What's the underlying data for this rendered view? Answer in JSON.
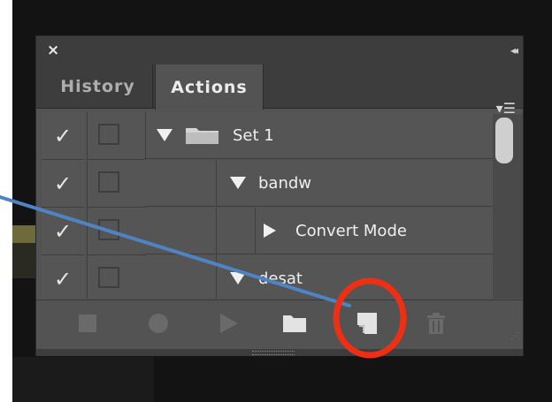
{
  "panel": {
    "close_icon": "close-icon",
    "collapse_icon": "collapse-double-arrow-icon",
    "tabs": [
      {
        "label": "History",
        "active": false
      },
      {
        "label": "Actions",
        "active": true
      }
    ],
    "panel_menu_icon": "panel-menu-icon"
  },
  "rows": [
    {
      "check": "✓",
      "expand": "down",
      "icon": "folder-icon",
      "label": "Set 1"
    },
    {
      "check": "✓",
      "expand": "down",
      "icon": "",
      "label": "bandw"
    },
    {
      "check": "✓",
      "expand": "right",
      "icon": "",
      "label": "Convert Mode"
    },
    {
      "check": "✓",
      "expand": "down",
      "icon": "",
      "label": "desat"
    }
  ],
  "toolbar": {
    "buttons": [
      {
        "name": "stop-playing-button",
        "icon": "stop-icon"
      },
      {
        "name": "begin-recording-button",
        "icon": "record-icon"
      },
      {
        "name": "play-selection-button",
        "icon": "play-icon"
      },
      {
        "name": "create-new-set-button",
        "icon": "folder-icon"
      },
      {
        "name": "create-new-action-button",
        "icon": "new-action-icon"
      },
      {
        "name": "delete-button",
        "icon": "trash-icon"
      }
    ]
  },
  "annotation": {
    "circle_color": "#ef2f14",
    "arrow_color": "#4f84c4",
    "highlighted": "create-new-action-button"
  },
  "colors": {
    "panel_bg": "#535353",
    "header_bg": "#3d3d3d",
    "text": "#efefef"
  }
}
